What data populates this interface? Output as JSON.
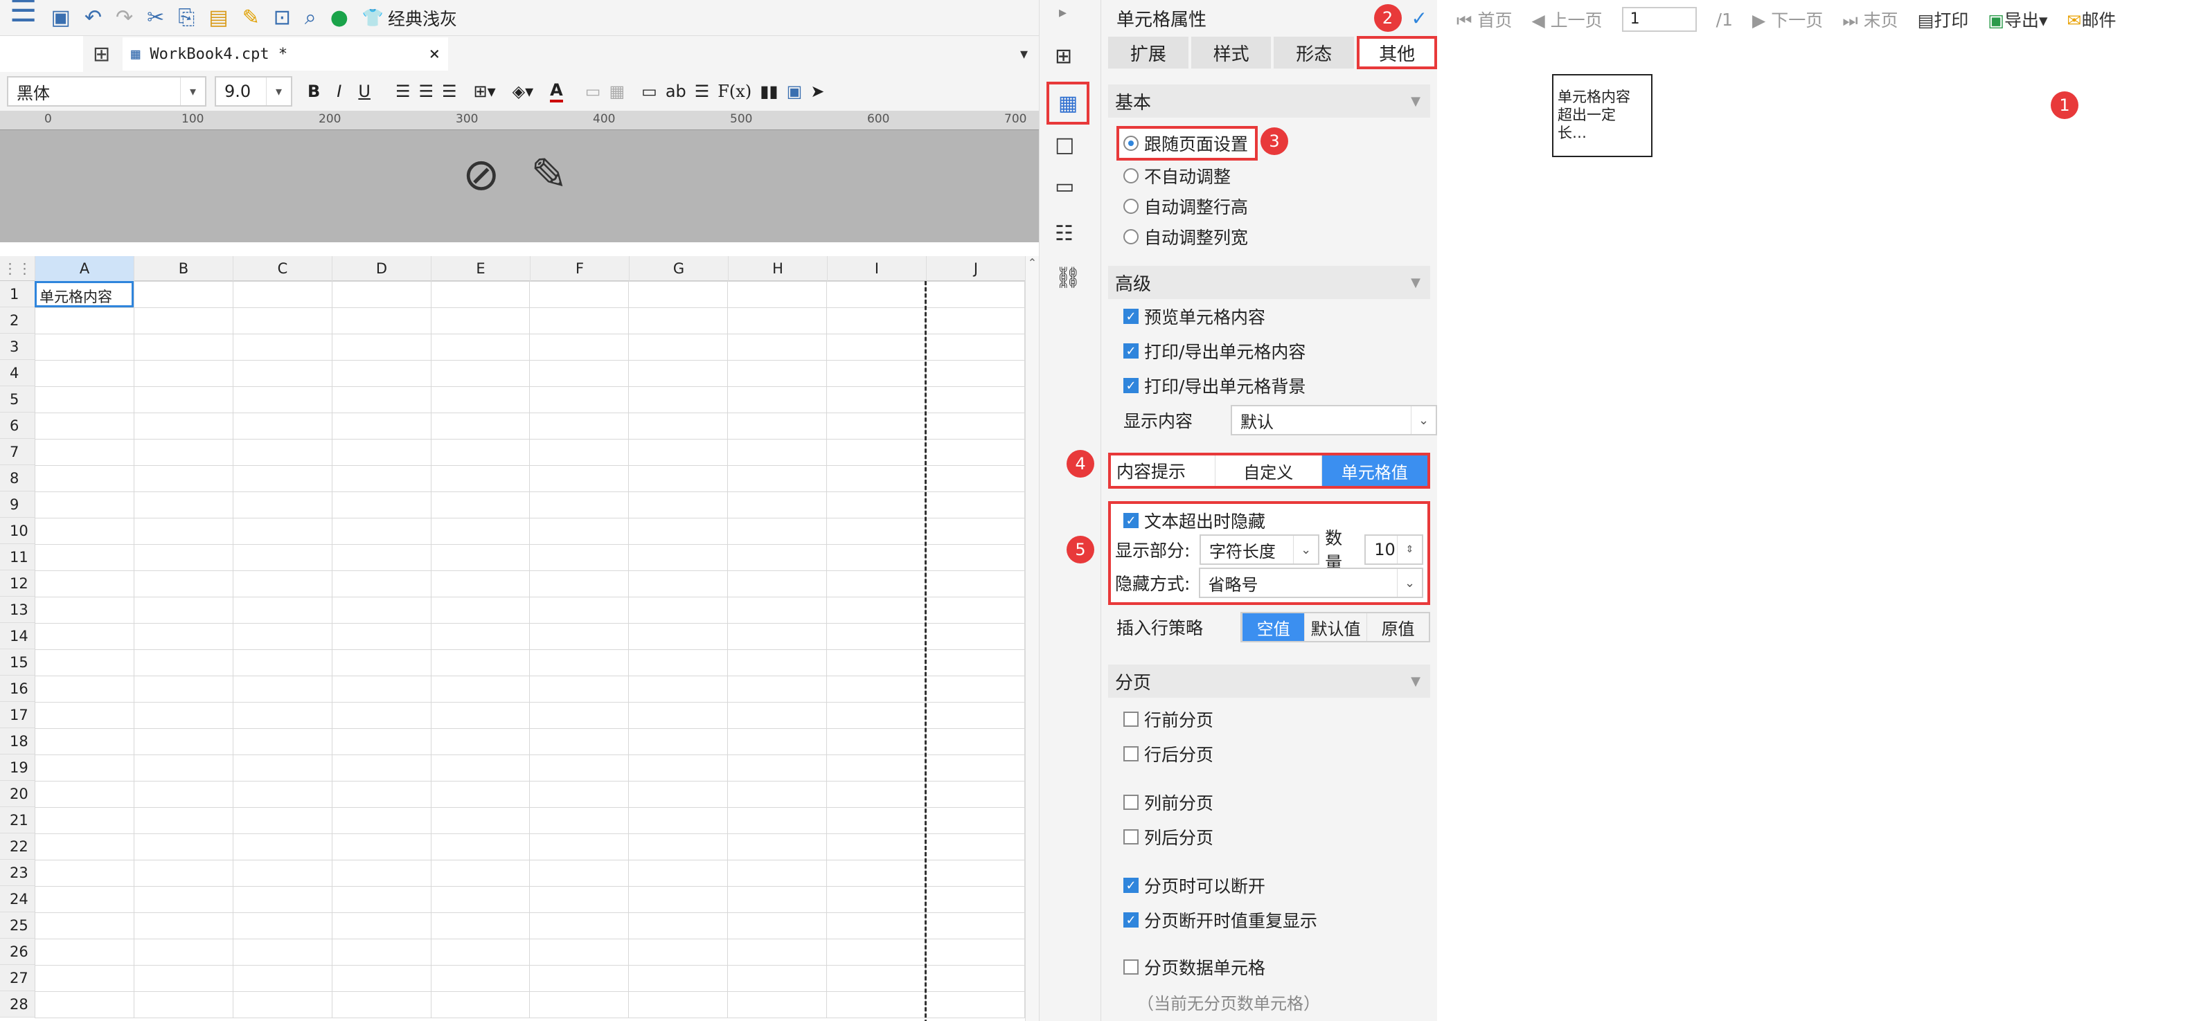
{
  "toolbar": {
    "theme": "经典浅灰"
  },
  "tab": {
    "name": "WorkBook4.cpt *"
  },
  "format": {
    "font": "黑体",
    "size": "9.0",
    "bold": "B",
    "italic": "I",
    "underline": "U",
    "font_color": "A",
    "ab": "ab",
    "fx": "F(x)"
  },
  "ruler": {
    "marks": [
      "0",
      "100",
      "200",
      "300",
      "400",
      "500",
      "600",
      "700"
    ]
  },
  "sheet": {
    "columns": [
      "A",
      "B",
      "C",
      "D",
      "E",
      "F",
      "G",
      "H",
      "I",
      "J"
    ],
    "rows": [
      "1",
      "2",
      "3",
      "4",
      "5",
      "6",
      "7",
      "8",
      "9",
      "10",
      "11",
      "12",
      "13",
      "14",
      "15",
      "16",
      "17",
      "18",
      "19",
      "20",
      "21",
      "22",
      "23",
      "24",
      "25",
      "26",
      "27",
      "28"
    ],
    "cell_a1": "单元格内容"
  },
  "panel": {
    "title": "单元格属性",
    "tabs": [
      "扩展",
      "样式",
      "形态",
      "其他"
    ],
    "basic": {
      "title": "基本",
      "options": [
        "跟随页面设置",
        "不自动调整",
        "自动调整行高",
        "自动调整列宽"
      ]
    },
    "advanced": {
      "title": "高级",
      "checks": [
        "预览单元格内容",
        "打印/导出单元格内容",
        "打印/导出单元格背景"
      ],
      "display_label": "显示内容",
      "display_value": "默认"
    },
    "tip": {
      "label": "内容提示",
      "opts": [
        "自定义",
        "单元格值"
      ]
    },
    "hide": {
      "check": "文本超出时隐藏",
      "part_label": "显示部分:",
      "part_value": "字符长度",
      "count_label": "数量",
      "count_value": "10",
      "mode_label": "隐藏方式:",
      "mode_value": "省略号"
    },
    "insert": {
      "label": "插入行策略",
      "opts": [
        "空值",
        "默认值",
        "原值"
      ]
    },
    "paging": {
      "title": "分页",
      "checks": [
        "行前分页",
        "行后分页",
        "列前分页",
        "列后分页",
        "分页时可以断开",
        "分页断开时值重复显示",
        "分页数据单元格"
      ],
      "note": "（当前无分页数单元格）"
    },
    "badges": [
      "1",
      "2",
      "3",
      "4",
      "5"
    ]
  },
  "preview": {
    "first": "首页",
    "prev": "上一页",
    "page": "1",
    "total": "/1",
    "next": "下一页",
    "last": "末页",
    "print": "打印",
    "export": "导出",
    "mail": "邮件",
    "box": [
      "单元格内容",
      "超出一定",
      "长…"
    ]
  }
}
